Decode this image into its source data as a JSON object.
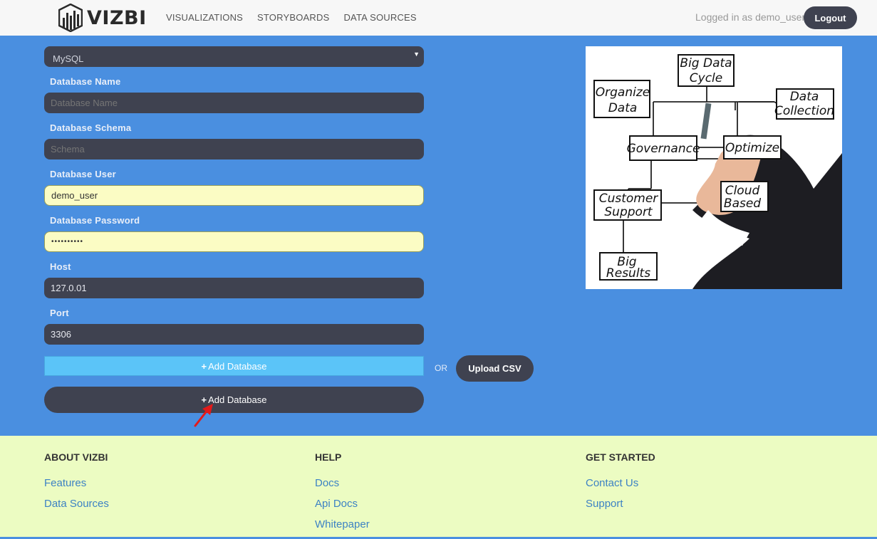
{
  "header": {
    "logo_text": "VIZBI",
    "nav": [
      "VISUALIZATIONS",
      "STORYBOARDS",
      "DATA SOURCES"
    ],
    "login_text": "Logged in as demo_user",
    "logout_label": "Logout"
  },
  "form": {
    "db_type": "MySQL",
    "db_name_label": "Database Name",
    "db_name_placeholder": "Database Name",
    "schema_label": "Database Schema",
    "schema_placeholder": "Schema",
    "user_label": "Database User",
    "user_value": "demo_user",
    "password_label": "Database Password",
    "password_value": "••••••••••",
    "host_label": "Host",
    "host_value": "127.0.01",
    "port_label": "Port",
    "port_value": "3306",
    "add_db_label": "Add Database",
    "or_label": "OR",
    "upload_label": "Upload CSV",
    "add_db_label_2": "Add Database"
  },
  "diagram": {
    "boxes": {
      "cycle": [
        "Big Data",
        "Cycle"
      ],
      "organize": [
        "Organize",
        "Data"
      ],
      "collection": [
        "Data",
        "Collection"
      ],
      "governance": [
        "Governance"
      ],
      "optimize": [
        "Optimize"
      ],
      "support": [
        "Customer",
        "Support"
      ],
      "cloud": [
        "Cloud",
        "Based"
      ],
      "results": [
        "Big",
        "Results"
      ]
    }
  },
  "footer": {
    "about_title": "ABOUT VIZBI",
    "about_links": [
      "Features",
      "Data Sources"
    ],
    "help_title": "HELP",
    "help_links": [
      "Docs",
      "Api Docs",
      "Whitepaper"
    ],
    "start_title": "GET STARTED",
    "start_links": [
      "Contact Us",
      "Support"
    ]
  }
}
